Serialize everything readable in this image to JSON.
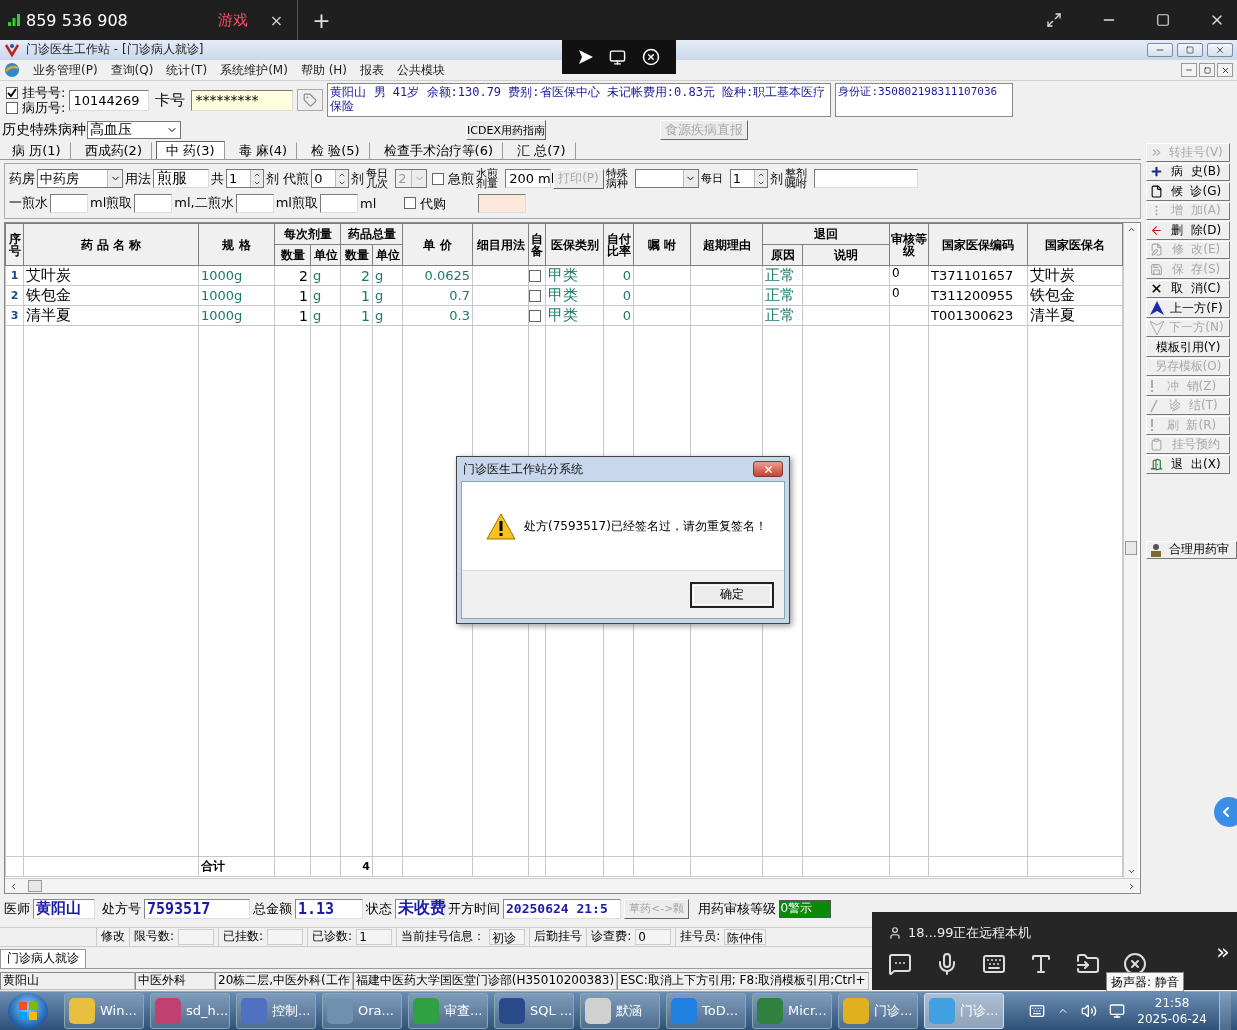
{
  "remote_bar": {
    "device_id": "859 536 908",
    "tab": "游戏",
    "tab_close": "×",
    "new_tab": "+"
  },
  "window": {
    "title": "门诊医生工作站 - [门诊病人就诊]"
  },
  "menu": [
    "业务管理(P)",
    "查询(Q)",
    "统计(T)",
    "系统维护(M)",
    "帮助 (H)",
    "报表",
    "公共模块"
  ],
  "patient": {
    "options": [
      {
        "label": "挂号号:",
        "checked": true
      },
      {
        "label": "病历号:",
        "checked": false
      }
    ],
    "reg_no": "10144269",
    "card_label": "卡号",
    "card_no": "*********",
    "info": "黄阳山  男  41岁  余额:130.79  费别:省医保中心  未记帐费用:0.83元  险种:职工基本医疗保险",
    "id_card": "身份证:350802198311107036"
  },
  "history": {
    "label": "历史特殊病种",
    "value": "高血压",
    "guide_button": "ICDEX用药指南",
    "report_button": "食源疾病直报"
  },
  "tabs": [
    {
      "label": "病 历(1)",
      "selected": false
    },
    {
      "label": "西成药(2)",
      "selected": false
    },
    {
      "label": "中 药(3)",
      "selected": true
    },
    {
      "label": "毒 麻(4)",
      "selected": false
    },
    {
      "label": "检 验(5)",
      "selected": false
    },
    {
      "label": "检查手术治疗等(6)",
      "selected": false
    },
    {
      "label": "汇 总(7)",
      "selected": false
    }
  ],
  "form": [
    [
      {
        "kind": "label",
        "text": "药房"
      },
      {
        "kind": "select",
        "value": "中药房",
        "disabled": false
      },
      {
        "kind": "label",
        "text": "用法"
      },
      {
        "kind": "input",
        "value": "煎服"
      },
      {
        "kind": "label",
        "text": "共"
      },
      {
        "kind": "spin",
        "value": "1"
      },
      {
        "kind": "label",
        "text": "剂 代煎"
      },
      {
        "kind": "spin",
        "value": "0"
      },
      {
        "kind": "label",
        "text": "剂"
      },
      {
        "kind": "label2",
        "text": "每日几次"
      },
      {
        "kind": "select",
        "value": "2",
        "disabled": true
      },
      {
        "kind": "check",
        "text": "急煎",
        "checked": false
      },
      {
        "kind": "label2",
        "text": "水煎剂量"
      },
      {
        "kind": "input",
        "value": "200 ml"
      },
      {
        "kind": "button",
        "text": "打印(P)",
        "disabled": true
      },
      {
        "kind": "label2",
        "text": "特殊病种"
      },
      {
        "kind": "select",
        "disabled": false
      },
      {
        "kind": "label2",
        "text": "每日"
      },
      {
        "kind": "spin",
        "value": "1"
      },
      {
        "kind": "label",
        "text": "剂"
      },
      {
        "kind": "label2",
        "text": "整剂嘱咐"
      },
      {
        "kind": "input"
      }
    ],
    [
      {
        "kind": "label",
        "text": "一煎水"
      },
      {
        "kind": "input"
      },
      {
        "kind": "label",
        "text": "ml煎取"
      },
      {
        "kind": "input"
      },
      {
        "kind": "label",
        "text": "ml,二煎水"
      },
      {
        "kind": "input"
      },
      {
        "kind": "label",
        "text": "ml煎取"
      },
      {
        "kind": "input"
      },
      {
        "kind": "label",
        "text": "ml"
      },
      {
        "kind": "check",
        "text": "代购",
        "checked": false
      },
      {
        "kind": "box"
      }
    ]
  ],
  "table": {
    "columns": [
      {
        "label": "序号"
      },
      {
        "label": "药 品 名 称"
      },
      {
        "label": "规  格"
      },
      {
        "label": "每次剂量",
        "children": [
          "数量",
          "单位"
        ]
      },
      {
        "label": "药品总量",
        "children": [
          "数量",
          "单位"
        ]
      },
      {
        "label": "单 价"
      },
      {
        "label": "细目用法"
      },
      {
        "label": "自备"
      },
      {
        "label": "医保类别"
      },
      {
        "label": "自付比率"
      },
      {
        "label": "嘱 咐"
      },
      {
        "label": "超期理由"
      },
      {
        "label": "退回",
        "children": [
          "原因",
          "说明"
        ]
      },
      {
        "label": "审核等级"
      },
      {
        "label": "国家医保编码"
      },
      {
        "label": "国家医保名"
      }
    ],
    "rows": [
      {
        "no": "1",
        "name": "艾叶炭",
        "spec": "1000g",
        "dose": "2",
        "dose_unit": "g",
        "total": "2",
        "total_unit": "g",
        "price": "0.0625",
        "self_supplied": false,
        "insurance_class": "甲类",
        "self_pay_ratio": "0",
        "reason": "正常",
        "review_level": "0",
        "code": "T371101657",
        "national_name": "艾叶炭"
      },
      {
        "no": "2",
        "name": "铁包金",
        "spec": "1000g",
        "dose": "1",
        "dose_unit": "g",
        "total": "1",
        "total_unit": "g",
        "price": "0.7",
        "self_supplied": false,
        "insurance_class": "甲类",
        "self_pay_ratio": "0",
        "reason": "正常",
        "review_level": "0",
        "code": "T311200955",
        "national_name": "铁包金"
      },
      {
        "no": "3",
        "name": "清半夏",
        "spec": "1000g",
        "dose": "1",
        "dose_unit": "g",
        "total": "1",
        "total_unit": "g",
        "price": "0.3",
        "self_supplied": false,
        "insurance_class": "甲类",
        "self_pay_ratio": "0",
        "reason": "正常",
        "code": "T001300623",
        "national_name": "清半夏"
      }
    ],
    "total_row": {
      "label": "合计",
      "total": "4"
    }
  },
  "sidebar": [
    {
      "label": "转挂号(V)",
      "disabled": true
    },
    {
      "label": "病  史(B)",
      "disabled": false
    },
    {
      "label": "候  诊(G)",
      "disabled": false
    },
    {
      "label": "增  加(A)",
      "disabled": true
    },
    {
      "label": "删  除(D)",
      "disabled": false
    },
    {
      "label": "修  改(E)",
      "disabled": true
    },
    {
      "label": "保  存(S)",
      "disabled": true
    },
    {
      "label": "取  消(C)",
      "disabled": false
    },
    {
      "label": "上一方(F)",
      "disabled": false
    },
    {
      "label": "下一方(N)",
      "disabled": true
    },
    {
      "label": "模板引用(Y)",
      "disabled": false
    },
    {
      "label": "另存模板(O)",
      "disabled": true
    },
    {
      "label": "冲  销(Z)",
      "disabled": true
    },
    {
      "label": "诊  结(T)",
      "disabled": true
    },
    {
      "label": "刷  新(R)",
      "disabled": true
    },
    {
      "label": "挂号预约",
      "disabled": true
    },
    {
      "label": "退  出(X)",
      "disabled": false
    }
  ],
  "review_button": "合理用药审",
  "summary": {
    "doctor_label": "医师",
    "doctor": "黄阳山",
    "rx_label": "处方号",
    "rx_no": "7593517",
    "amount_label": "总金额",
    "amount": "1.13",
    "status_label": "状态",
    "status": "未收费",
    "time_label": "开方时间",
    "time": "20250624 21:5",
    "switch_button": "草药<->颗",
    "review_label": "用药审核等级",
    "review": "0警示"
  },
  "reg_info": [
    {
      "label": "修改"
    },
    {
      "label": "限号数:"
    },
    {
      "label": "已挂数:"
    },
    {
      "label": "已诊数:",
      "value": "1"
    },
    {
      "label": "当前挂号信息：",
      "value": "初诊"
    },
    {
      "label": "后勤挂号"
    },
    {
      "label": "诊查费:",
      "value": "0"
    },
    {
      "label": "挂号员:",
      "value": "陈仲伟"
    }
  ],
  "doc_tab": "门诊病人就诊",
  "status_bar": [
    "黄阳山",
    "中医外科",
    "20栋二层,中医外科(工作",
    "福建中医药大学国医堂门诊部(H35010200383)",
    "ESC:取消上下方引用; F8:取消模板引用;Ctrl+"
  ],
  "taskbar": {
    "items": [
      {
        "label": "Win...",
        "selected": false
      },
      {
        "label": "sd_h...",
        "selected": false
      },
      {
        "label": "控制...",
        "selected": false
      },
      {
        "label": "Ora...",
        "selected": false
      },
      {
        "label": "审查...",
        "selected": false
      },
      {
        "label": "SQL ...",
        "selected": false
      },
      {
        "label": "默涵",
        "selected": false
      },
      {
        "label": "ToD...",
        "selected": false
      },
      {
        "label": "Micr...",
        "selected": false
      },
      {
        "label": "门诊...",
        "selected": false
      },
      {
        "label": "门诊...",
        "selected": true
      }
    ],
    "time": "21:58",
    "date": "2025-06-24"
  },
  "dialog": {
    "title": "门诊医生工作站分系统",
    "message": "处方(7593517)已经签名过，请勿重复签名！",
    "ok": "确定"
  },
  "remote_panel": {
    "status": "18...99正在远程本机",
    "tooltip": "扬声器: 静音",
    "more": "»"
  }
}
